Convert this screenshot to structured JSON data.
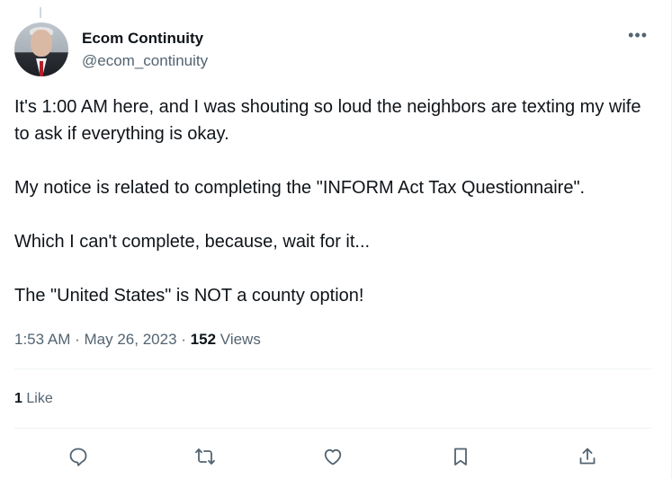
{
  "author": {
    "display_name": "Ecom Continuity",
    "handle": "@ecom_continuity"
  },
  "more_label": "•••",
  "tweet": {
    "paragraphs": [
      "It's 1:00 AM here, and I was shouting so loud the neighbors are texting my wife to ask if everything is okay.",
      "My notice is related to completing the \"INFORM Act Tax Questionnaire\".",
      "Which I can't complete, because, wait for it...",
      "The \"United States\" is NOT a county option!"
    ]
  },
  "meta": {
    "time": "1:53 AM",
    "separator": "·",
    "date": "May 26, 2023",
    "views_count": "152",
    "views_label": "Views"
  },
  "engagement": {
    "likes_count": "1",
    "likes_label": "Like"
  },
  "actions": [
    {
      "name": "reply",
      "icon": "reply-icon"
    },
    {
      "name": "retweet",
      "icon": "retweet-icon"
    },
    {
      "name": "like",
      "icon": "heart-icon"
    },
    {
      "name": "bookmark",
      "icon": "bookmark-icon"
    },
    {
      "name": "share",
      "icon": "share-icon"
    }
  ],
  "colors": {
    "text_primary": "#0f1419",
    "text_secondary": "#536471",
    "divider": "#eff3f4",
    "icon": "#536471"
  }
}
